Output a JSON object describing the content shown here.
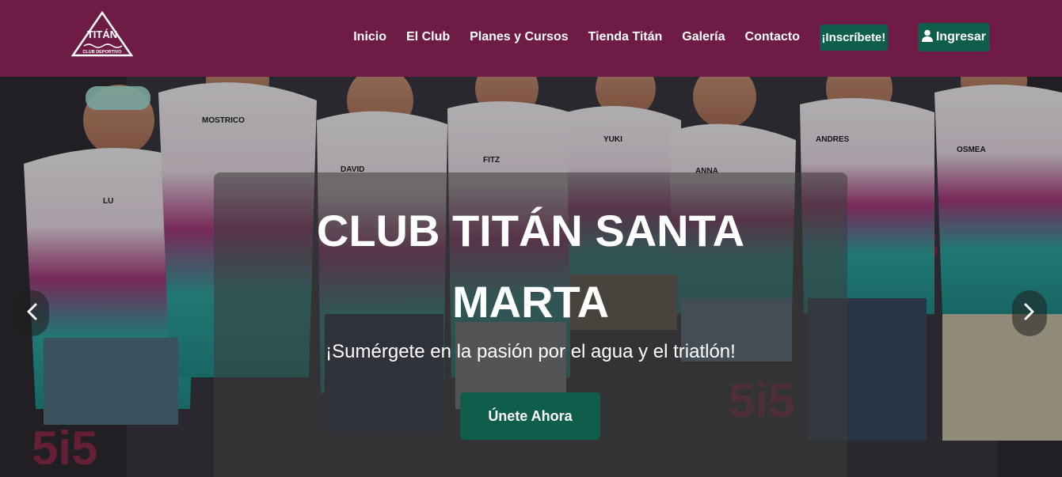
{
  "brand": {
    "logo_text": "TITÁN",
    "logo_subtext": "CLUB DEPORTIVO",
    "color": "#6e1c46",
    "accent": "#0f5e4c"
  },
  "nav": {
    "items": [
      {
        "label": "Inicio"
      },
      {
        "label": "El Club"
      },
      {
        "label": "Planes y Cursos"
      },
      {
        "label": "Tienda Titán"
      },
      {
        "label": "Galería"
      },
      {
        "label": "Contacto"
      }
    ],
    "join_label": "¡Inscríbete!",
    "login_label": "Ingresar",
    "login_icon": "user-icon"
  },
  "hero": {
    "title_line1": "CLUB TITÁN SANTA",
    "title_line2": "MARTA",
    "subtitle": "¡Sumérgete en la pasión por el agua y el triatlón!",
    "cta_label": "Únete Ahora",
    "prev_icon": "chevron-left-icon",
    "next_icon": "chevron-right-icon",
    "jersey_names": [
      "LU",
      "MOSTRICO",
      "DAVID",
      "FITZ",
      "YUKI",
      "ANNA",
      "ANDRES",
      "OSMEA"
    ]
  }
}
